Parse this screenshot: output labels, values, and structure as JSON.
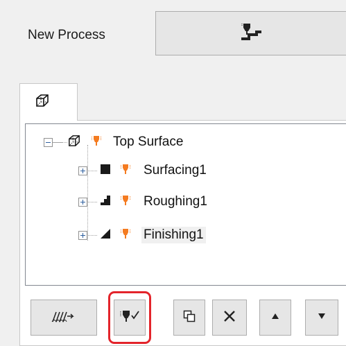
{
  "new_process": {
    "label": "New Process"
  },
  "tabs": [
    {
      "icon": "box-3d-icon",
      "selected": true
    }
  ],
  "tree": {
    "root": {
      "label": "Top Surface",
      "expanded": true,
      "icons": [
        "box-3d-icon",
        "tool-orange-icon"
      ]
    },
    "children": [
      {
        "label": "Surfacing1",
        "expanded": false,
        "icons": [
          "square-filled-icon",
          "tool-orange-icon"
        ]
      },
      {
        "label": "Roughing1",
        "expanded": false,
        "icons": [
          "steps-icon",
          "tool-orange-icon"
        ]
      },
      {
        "label": "Finishing1",
        "expanded": false,
        "selected": true,
        "icons": [
          "triangle-icon",
          "tool-orange-icon"
        ]
      }
    ]
  },
  "toolbar": {
    "buttons": [
      "hatch-toolpath-icon",
      "tool-check-icon",
      "copy-icon",
      "delete-x-icon",
      "move-up-icon",
      "move-down-icon"
    ],
    "highlighted": "tool-check-icon"
  },
  "colors": {
    "highlight": "#e3242b",
    "tool_orange": "#f47b20",
    "selection": "#f0f0f0"
  }
}
